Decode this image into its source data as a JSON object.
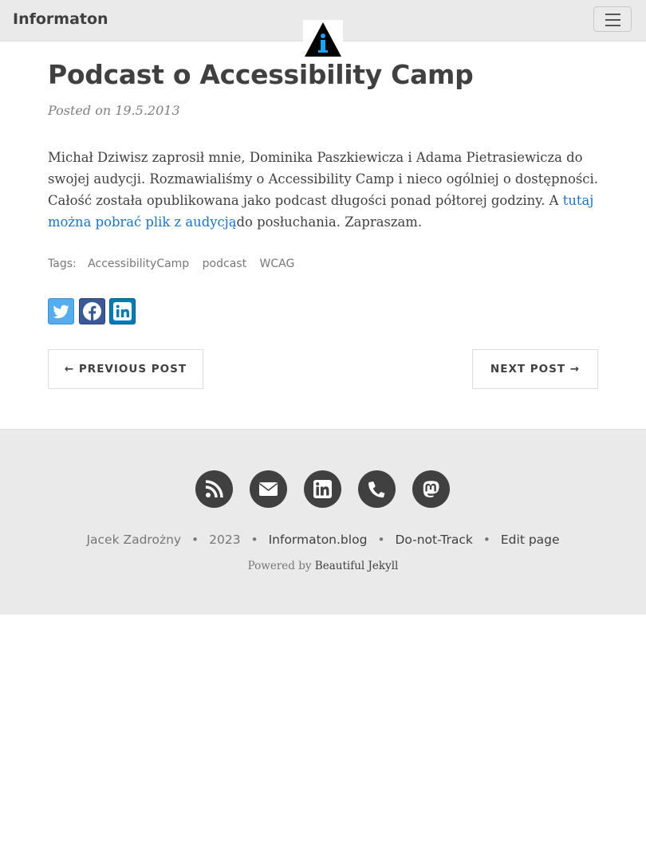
{
  "navbar": {
    "brand": "Informaton",
    "toggle_icon": "hamburger-menu-icon",
    "logo_icon": "info-i-triangle-logo"
  },
  "post": {
    "title": "Podcast o Accessibility Camp",
    "meta": "Posted on 19.5.2013",
    "body_text": "Michał Dziwisz zaprosił mnie, Dominika Paszkiewicza i Adama Pietrasiewicza do swojej audycji. Rozmawialiśmy o Accessibility Camp i nieco ogólniej o dostępności. Całość została opublikowana jako podcast długości ponad półtorej godziny. A ",
    "body_link": "tutaj można pobrać plik z audycją",
    "body_after": "do posłuchania. Zapraszam.",
    "tags_label": "Tags:",
    "tags": [
      "AccessibilityCamp",
      "podcast",
      "WCAG"
    ]
  },
  "share": {
    "twitter_icon": "twitter-icon",
    "facebook_icon": "facebook-icon",
    "linkedin_icon": "linkedin-icon"
  },
  "pager": {
    "previous": "← PREVIOUS POST",
    "next": "NEXT POST →"
  },
  "footer": {
    "social_icons": [
      "rss-icon",
      "envelope-icon",
      "linkedin-icon",
      "phone-icon",
      "mastodon-icon"
    ],
    "author": "Jacek Zadrożny",
    "year": "2023",
    "site": "Informaton.blog",
    "dnt": "Do-not-Track",
    "edit": "Edit page",
    "separator": "•",
    "powered_prefix": "Powered by ",
    "powered_link": "Beautiful Jekyll"
  },
  "colors": {
    "navbar_bg": "#eaeaea",
    "text": "#404040",
    "link": "#1a73c8",
    "footer_bg": "#eaeaea"
  }
}
